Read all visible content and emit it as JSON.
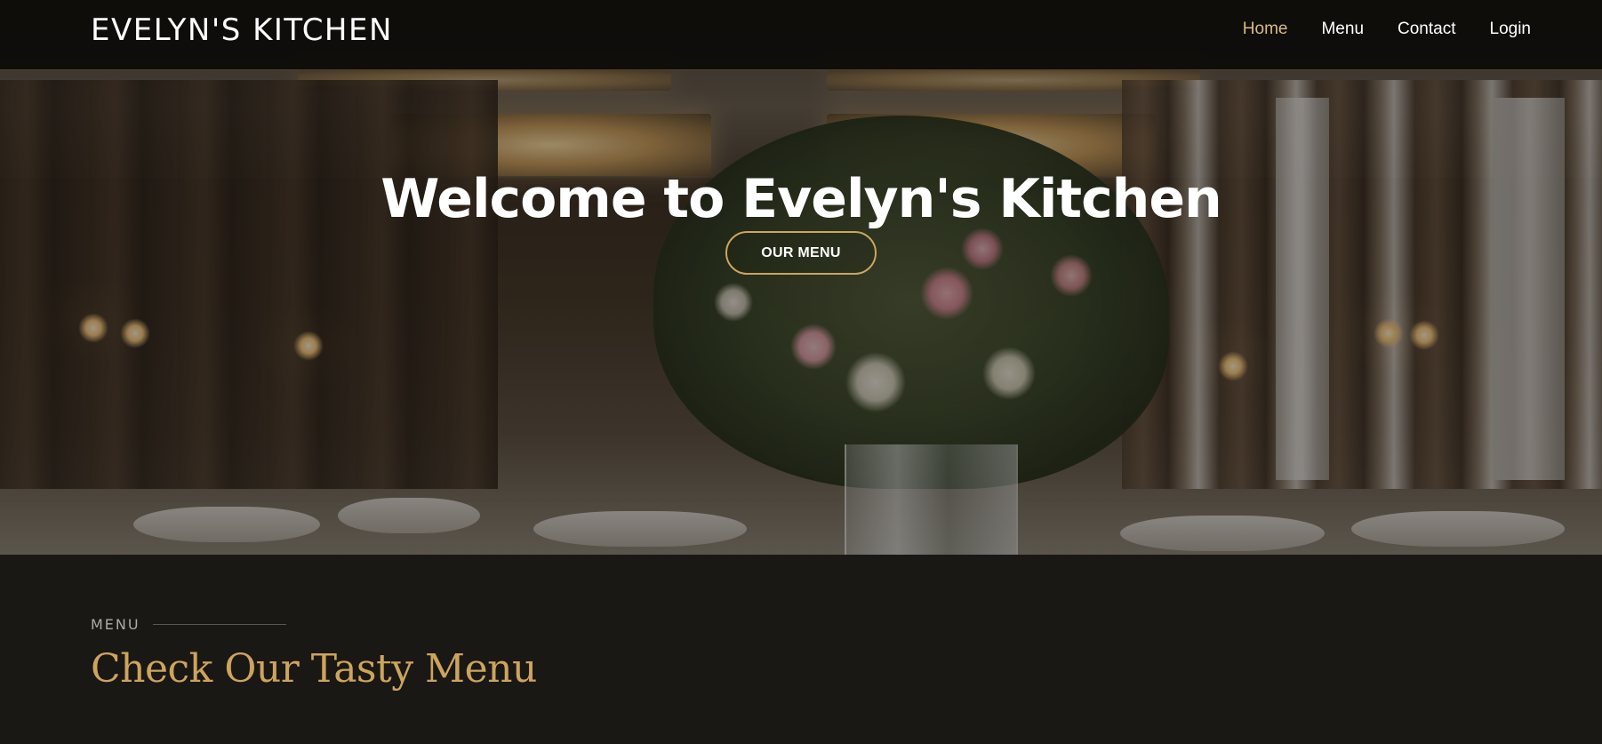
{
  "header": {
    "logo": "EVELYN'S KITCHEN",
    "nav": [
      {
        "label": "Home",
        "active": true
      },
      {
        "label": "Menu",
        "active": false
      },
      {
        "label": "Contact",
        "active": false
      },
      {
        "label": "Login",
        "active": false
      }
    ]
  },
  "hero": {
    "title": "Welcome to Evelyn's Kitchen",
    "button_label": "OUR MENU"
  },
  "menu_section": {
    "label": "MENU",
    "title": "Check Our Tasty Menu"
  },
  "colors": {
    "accent": "#cda45e",
    "active_nav": "#d9ba85",
    "page_background": "#1a1814",
    "header_background": "#0c0b09"
  }
}
